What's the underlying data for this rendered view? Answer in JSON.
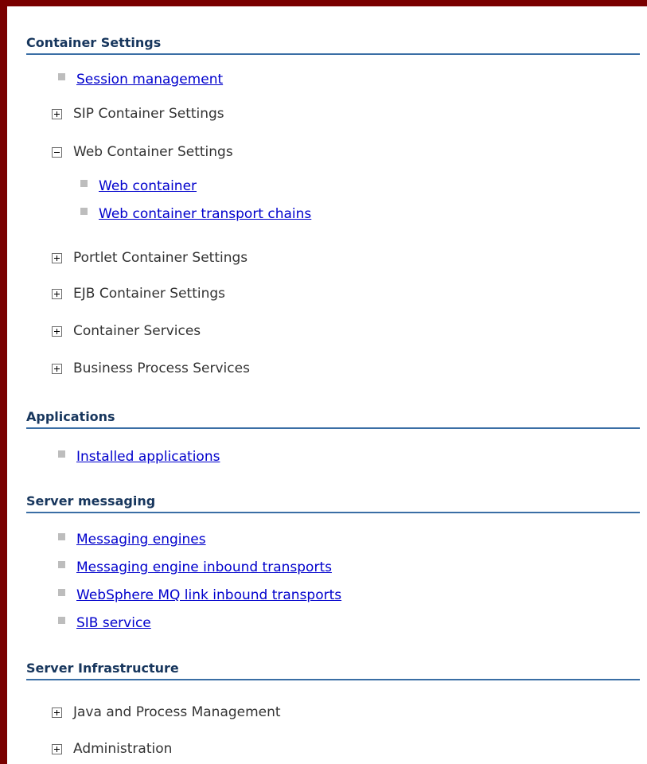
{
  "sections": {
    "container_settings": {
      "title": "Container Settings",
      "session_management": "Session management",
      "sip_container_settings": "SIP Container Settings",
      "web_container_settings": "Web Container Settings",
      "web_container": "Web container",
      "web_container_transport_chains": "Web container transport chains",
      "portlet_container_settings": "Portlet Container Settings",
      "ejb_container_settings": "EJB Container Settings",
      "container_services": "Container Services",
      "business_process_services": "Business Process Services"
    },
    "applications": {
      "title": "Applications",
      "installed_applications": "Installed applications"
    },
    "server_messaging": {
      "title": "Server messaging",
      "messaging_engines": "Messaging engines",
      "messaging_engine_inbound_transports": "Messaging engine inbound transports",
      "websphere_mq_link_inbound_transports": "WebSphere MQ link inbound transports",
      "sib_service": "SIB service"
    },
    "server_infrastructure": {
      "title": "Server Infrastructure",
      "java_and_process_management": "Java and Process Management",
      "administration": "Administration"
    }
  },
  "colors": {
    "frame": "#7a0000",
    "section_title": "#17365d",
    "section_rule": "#3a6ea5",
    "link": "#0000cc"
  }
}
